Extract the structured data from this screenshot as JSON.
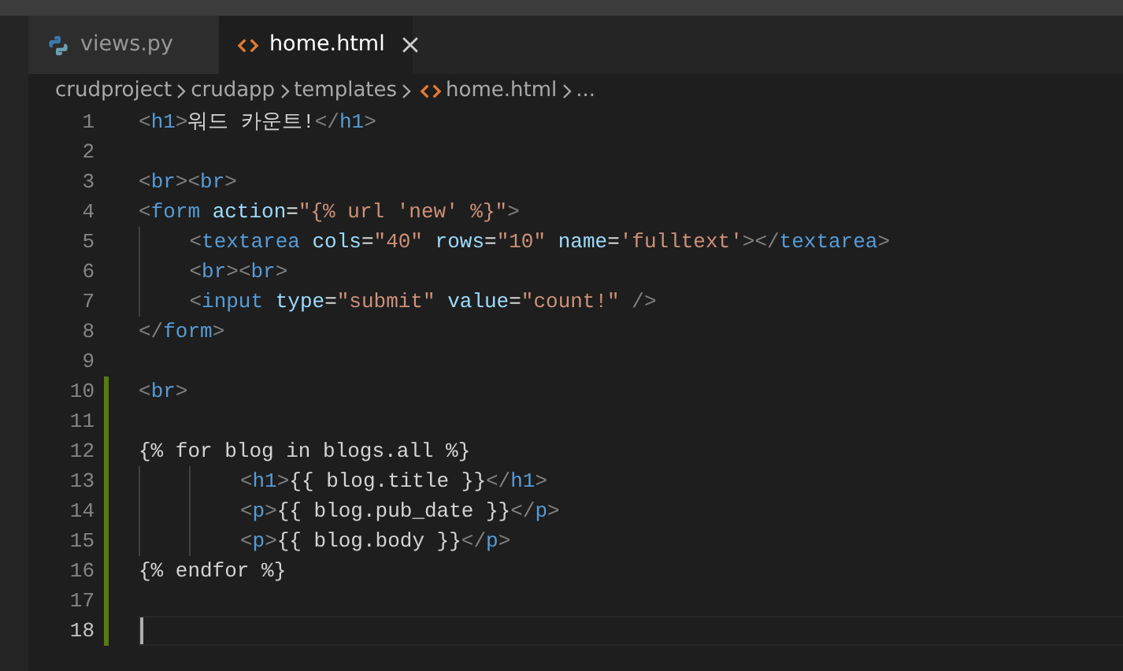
{
  "tabs": [
    {
      "label": "views.py",
      "kind": "python",
      "selected": false
    },
    {
      "label": "home.html",
      "kind": "html",
      "selected": true
    }
  ],
  "breadcrumbs": [
    {
      "label": "crudproject",
      "kind": "folder"
    },
    {
      "label": "crudapp",
      "kind": "folder"
    },
    {
      "label": "templates",
      "kind": "folder"
    },
    {
      "label": "home.html",
      "kind": "html"
    },
    {
      "label": "...",
      "kind": "more"
    }
  ],
  "lines": [
    {
      "number": "1",
      "modified": false,
      "current": false,
      "tokens": [
        {
          "t": "<",
          "kind": "punct"
        },
        {
          "t": "h1",
          "kind": "tag"
        },
        {
          "t": ">",
          "kind": "punct"
        },
        {
          "t": "워드 카운트!",
          "kind": "text"
        },
        {
          "t": "</",
          "kind": "punct"
        },
        {
          "t": "h1",
          "kind": "tag"
        },
        {
          "t": ">",
          "kind": "punct"
        }
      ]
    },
    {
      "number": "2",
      "modified": false,
      "current": false
    },
    {
      "number": "3",
      "modified": false,
      "current": false,
      "tokens": [
        {
          "t": "<",
          "kind": "punct"
        },
        {
          "t": "br",
          "kind": "tag"
        },
        {
          "t": "><",
          "kind": "punct"
        },
        {
          "t": "br",
          "kind": "tag"
        },
        {
          "t": ">",
          "kind": "punct"
        }
      ]
    },
    {
      "number": "4",
      "modified": false,
      "current": false,
      "tokens": [
        {
          "t": "<",
          "kind": "punct"
        },
        {
          "t": "form",
          "kind": "tag"
        },
        {
          "t": " action",
          "kind": "attr"
        },
        {
          "t": "=",
          "kind": "text"
        },
        {
          "t": "\"{% url 'new' %}\"",
          "kind": "string"
        },
        {
          "t": ">",
          "kind": "punct"
        }
      ]
    },
    {
      "number": "5",
      "modified": false,
      "current": false,
      "tokens": [
        {
          "t": "    <",
          "kind": "punct"
        },
        {
          "t": "textarea",
          "kind": "tag"
        },
        {
          "t": " cols",
          "kind": "attr"
        },
        {
          "t": "=",
          "kind": "text"
        },
        {
          "t": "\"40\"",
          "kind": "string"
        },
        {
          "t": " rows",
          "kind": "attr"
        },
        {
          "t": "=",
          "kind": "text"
        },
        {
          "t": "\"10\"",
          "kind": "string"
        },
        {
          "t": " name",
          "kind": "attr"
        },
        {
          "t": "=",
          "kind": "text"
        },
        {
          "t": "'fulltext'",
          "kind": "string"
        },
        {
          "t": "></",
          "kind": "punct"
        },
        {
          "t": "textarea",
          "kind": "tag"
        },
        {
          "t": ">",
          "kind": "punct"
        }
      ]
    },
    {
      "number": "6",
      "modified": false,
      "current": false,
      "tokens": [
        {
          "t": "    <",
          "kind": "punct"
        },
        {
          "t": "br",
          "kind": "tag"
        },
        {
          "t": "><",
          "kind": "punct"
        },
        {
          "t": "br",
          "kind": "tag"
        },
        {
          "t": ">",
          "kind": "punct"
        }
      ]
    },
    {
      "number": "7",
      "modified": false,
      "current": false,
      "tokens": [
        {
          "t": "    <",
          "kind": "punct"
        },
        {
          "t": "input",
          "kind": "tag"
        },
        {
          "t": " type",
          "kind": "attr"
        },
        {
          "t": "=",
          "kind": "text"
        },
        {
          "t": "\"submit\"",
          "kind": "string"
        },
        {
          "t": " value",
          "kind": "attr"
        },
        {
          "t": "=",
          "kind": "text"
        },
        {
          "t": "\"count!\"",
          "kind": "string"
        },
        {
          "t": " />",
          "kind": "punct"
        }
      ]
    },
    {
      "number": "8",
      "modified": false,
      "current": false,
      "tokens": [
        {
          "t": "</",
          "kind": "punct"
        },
        {
          "t": "form",
          "kind": "tag"
        },
        {
          "t": ">",
          "kind": "punct"
        }
      ]
    },
    {
      "number": "9",
      "modified": false,
      "current": false
    },
    {
      "number": "10",
      "modified": true,
      "current": false,
      "tokens": [
        {
          "t": "<",
          "kind": "punct"
        },
        {
          "t": "br",
          "kind": "tag"
        },
        {
          "t": ">",
          "kind": "punct"
        }
      ]
    },
    {
      "number": "11",
      "modified": true,
      "current": false
    },
    {
      "number": "12",
      "modified": true,
      "current": false,
      "tokens": [
        {
          "t": "{% for blog in blogs.all %}",
          "kind": "text"
        }
      ]
    },
    {
      "number": "13",
      "modified": true,
      "current": false,
      "tokens": [
        {
          "t": "        <",
          "kind": "punct"
        },
        {
          "t": "h1",
          "kind": "tag"
        },
        {
          "t": ">",
          "kind": "punct"
        },
        {
          "t": "{{ blog.title }}",
          "kind": "text"
        },
        {
          "t": "</",
          "kind": "punct"
        },
        {
          "t": "h1",
          "kind": "tag"
        },
        {
          "t": ">",
          "kind": "punct"
        }
      ]
    },
    {
      "number": "14",
      "modified": true,
      "current": false,
      "tokens": [
        {
          "t": "        <",
          "kind": "punct"
        },
        {
          "t": "p",
          "kind": "tag"
        },
        {
          "t": ">",
          "kind": "punct"
        },
        {
          "t": "{{ blog.pub_date }}",
          "kind": "text"
        },
        {
          "t": "</",
          "kind": "punct"
        },
        {
          "t": "p",
          "kind": "tag"
        },
        {
          "t": ">",
          "kind": "punct"
        }
      ]
    },
    {
      "number": "15",
      "modified": true,
      "current": false,
      "tokens": [
        {
          "t": "        <",
          "kind": "punct"
        },
        {
          "t": "p",
          "kind": "tag"
        },
        {
          "t": ">",
          "kind": "punct"
        },
        {
          "t": "{{ blog.body }}",
          "kind": "text"
        },
        {
          "t": "</",
          "kind": "punct"
        },
        {
          "t": "p",
          "kind": "tag"
        },
        {
          "t": ">",
          "kind": "punct"
        }
      ]
    },
    {
      "number": "16",
      "modified": true,
      "current": false,
      "tokens": [
        {
          "t": "{% endfor %}",
          "kind": "text"
        }
      ]
    },
    {
      "number": "17",
      "modified": true,
      "current": false
    },
    {
      "number": "18",
      "modified": true,
      "current": true
    }
  ]
}
